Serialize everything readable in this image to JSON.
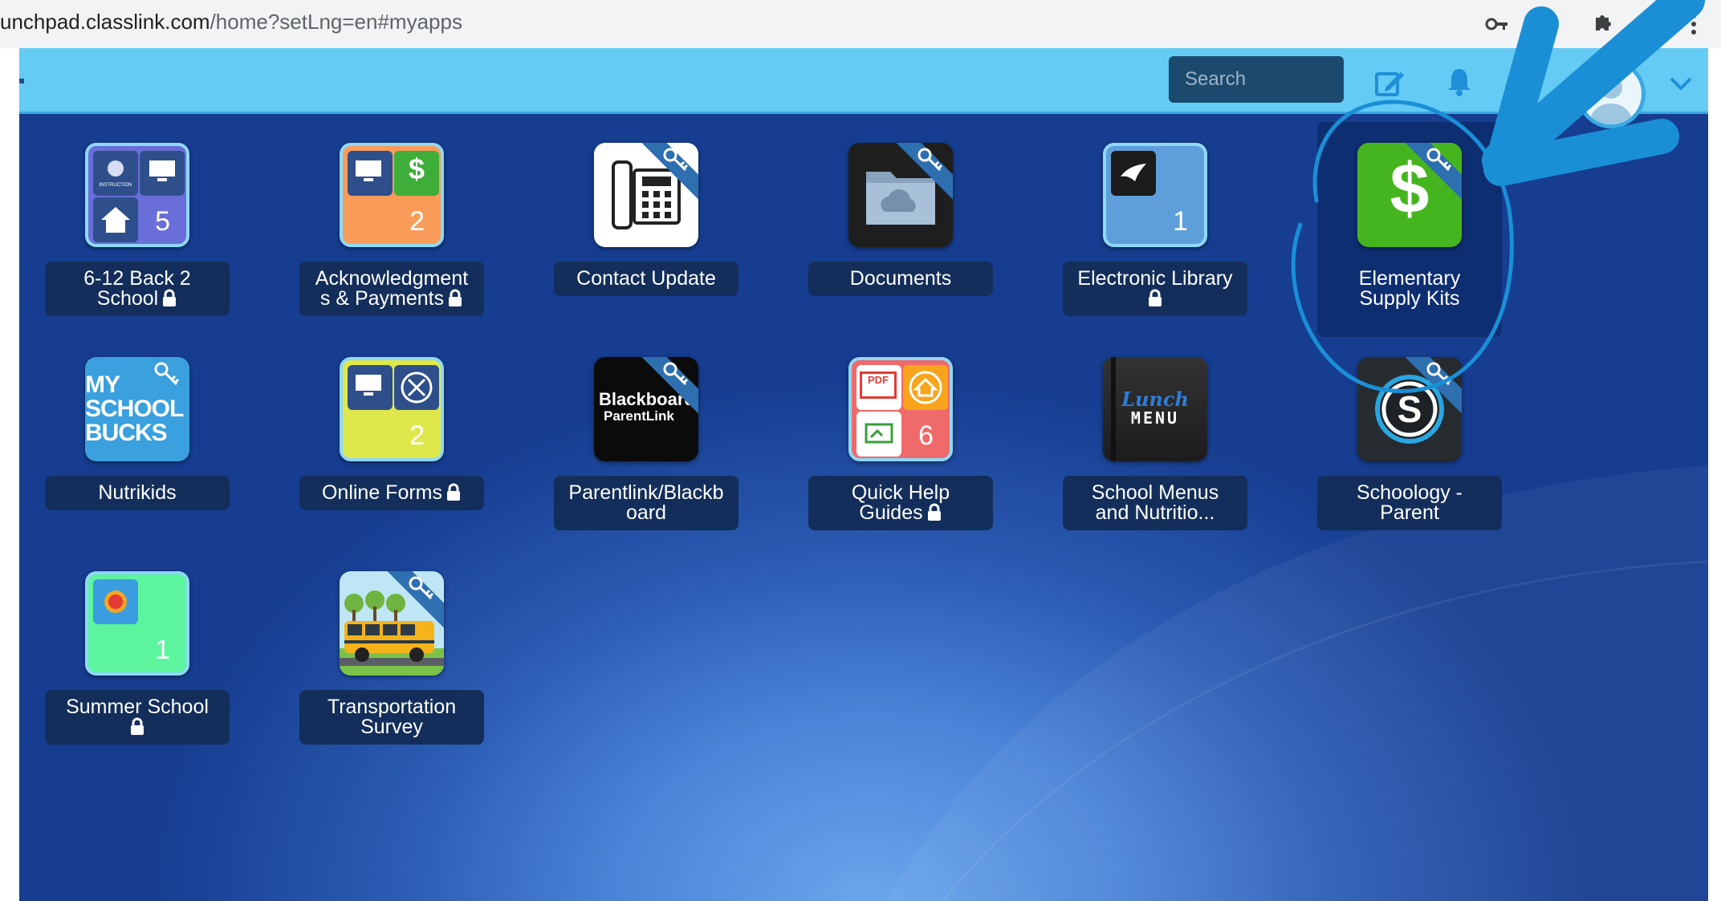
{
  "browser": {
    "url_host": "unchpad.classlink.com",
    "url_path": "/home?setLng=en#myapps",
    "icons": [
      "key-icon",
      "extensions-icon",
      "more-menu-icon"
    ]
  },
  "header": {
    "search_placeholder": "Search",
    "icons": [
      "edit-icon",
      "bell-icon",
      "avatar",
      "chevron-down-icon"
    ]
  },
  "colors": {
    "topbar": "#63cbf4",
    "label_bg": "#132e5a",
    "annotation": "#1a8fd6"
  },
  "apps": [
    {
      "label_line1": "6-12 Back 2",
      "label_line2": "School",
      "locked": true,
      "count": "5",
      "icon": "folder-instruction-icon"
    },
    {
      "label_line1": "Acknowledgment",
      "label_line2": "s & Payments",
      "locked": true,
      "count": "2",
      "icon": "folder-payments-icon"
    },
    {
      "label_line1": "Contact Update",
      "label_line2": "",
      "locked": false,
      "count": "",
      "icon": "phone-icon"
    },
    {
      "label_line1": "Documents",
      "label_line2": "",
      "locked": false,
      "count": "",
      "icon": "cloud-folder-icon"
    },
    {
      "label_line1": "Electronic Library",
      "label_line2": "",
      "locked": true,
      "count": "1",
      "icon": "folder-book-icon"
    },
    {
      "label_line1": "Elementary",
      "label_line2": "Supply Kits",
      "locked": false,
      "count": "",
      "icon": "dollar-icon"
    },
    {
      "label_line1": "Nutrikids",
      "label_line2": "",
      "locked": false,
      "count": "",
      "icon": "myschoolbucks-icon"
    },
    {
      "label_line1": "Online Forms",
      "label_line2": "",
      "locked": true,
      "count": "2",
      "icon": "folder-forms-icon"
    },
    {
      "label_line1": "Parentlink/Blackb",
      "label_line2": "oard",
      "locked": false,
      "count": "",
      "icon": "blackboard-parentlink-icon"
    },
    {
      "label_line1": "Quick Help",
      "label_line2": "Guides",
      "locked": true,
      "count": "6",
      "icon": "folder-help-icon"
    },
    {
      "label_line1": "School Menus",
      "label_line2": "and Nutritio...",
      "locked": false,
      "count": "",
      "icon": "lunch-menu-icon"
    },
    {
      "label_line1": "Schoology -",
      "label_line2": "Parent",
      "locked": false,
      "count": "",
      "icon": "schoology-icon"
    },
    {
      "label_line1": "Summer School",
      "label_line2": "",
      "locked": true,
      "count": "1",
      "icon": "folder-sun-icon"
    },
    {
      "label_line1": "Transportation",
      "label_line2": "Survey",
      "locked": false,
      "count": "",
      "icon": "school-bus-icon"
    }
  ],
  "icon_text": {
    "myschoolbucks_1": "MY",
    "myschoolbucks_2": "SCHOOL",
    "myschoolbucks_3": "BUCKS",
    "blackboard_1": "Blackboard",
    "blackboard_2": "ParentLink",
    "lunch_1": "Lunch",
    "lunch_2": "MENU",
    "instruction_tag": "INSTRUCTION",
    "pdf_tag": "PDF",
    "dollar": "$"
  }
}
